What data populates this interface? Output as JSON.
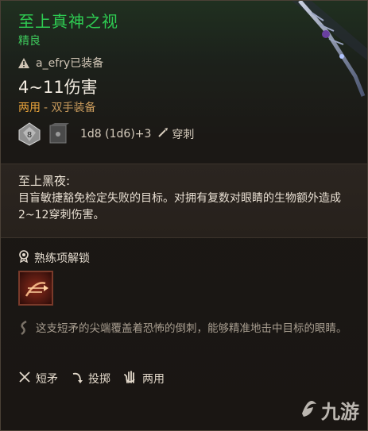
{
  "item": {
    "name": "至上真神之视",
    "rarity": "精良",
    "equipped_by": "a_efry已装备",
    "damage": "4~11伤害",
    "handedness": {
      "primary": "两用",
      "secondary": "- 双手装备"
    },
    "dice": {
      "die_label": "8",
      "formula": "1d8 (1d6)+3",
      "damage_type": "穿刺"
    }
  },
  "special": {
    "title": "至上黑夜:",
    "description": "目盲敏捷豁免检定失败的目标。对拥有复数对眼睛的生物额外造成2~12穿刺伤害。"
  },
  "proficiency": {
    "label": "熟练项解锁"
  },
  "flavor": "这支短矛的尖端覆盖着恐怖的倒刺，能够精准地击中目标的眼睛。",
  "properties": [
    {
      "icon": "spear-icon",
      "label": "短矛"
    },
    {
      "icon": "throw-icon",
      "label": "投掷"
    },
    {
      "icon": "hand-icon",
      "label": "两用"
    }
  ],
  "watermark": "九游",
  "colors": {
    "title": "#2ecc52",
    "accent_orange": "#e8a23a"
  }
}
